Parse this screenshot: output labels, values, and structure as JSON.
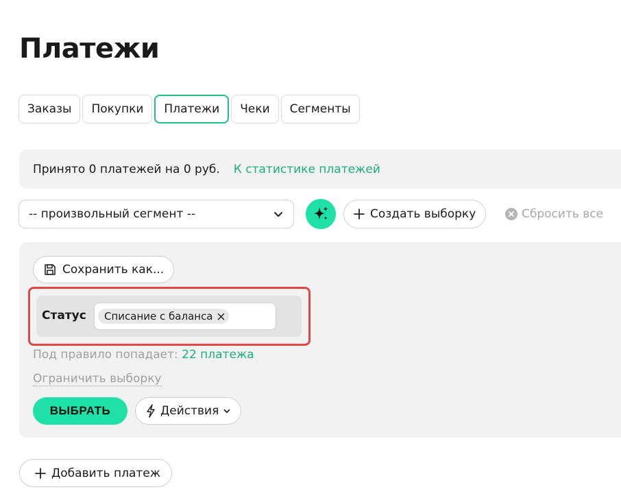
{
  "page": {
    "title": "Платежи"
  },
  "tabs": [
    {
      "label": "Заказы",
      "active": false
    },
    {
      "label": "Покупки",
      "active": false
    },
    {
      "label": "Платежи",
      "active": true
    },
    {
      "label": "Чеки",
      "active": false
    },
    {
      "label": "Сегменты",
      "active": false
    }
  ],
  "info_bar": {
    "summary": "Принято 0 платежей на 0 руб.",
    "stats_link": "К статистике платежей"
  },
  "toolbar": {
    "segment_value": "-- произвольный сегмент --",
    "ai_icon": "sparkles-icon",
    "create_label": "Создать выборку",
    "reset_label": "Сбросить все"
  },
  "filter": {
    "save_as_label": "Сохранить как...",
    "status_label": "Статус",
    "status_chip": "Списание с баланса",
    "rule_prefix": "Под правило попадает:",
    "rule_count": "22 платежа",
    "limit_label": "Ограничить выборку",
    "select_label": "ВЫБРАТЬ",
    "actions_label": "Действия"
  },
  "footer": {
    "add_payment_label": "Добавить платеж"
  },
  "colors": {
    "accent": "#1fe0a6",
    "link": "#1aaf7a",
    "active_tab_border": "#1fbf8a",
    "highlight": "#e04848",
    "panel_bg": "#f2f2f2"
  }
}
